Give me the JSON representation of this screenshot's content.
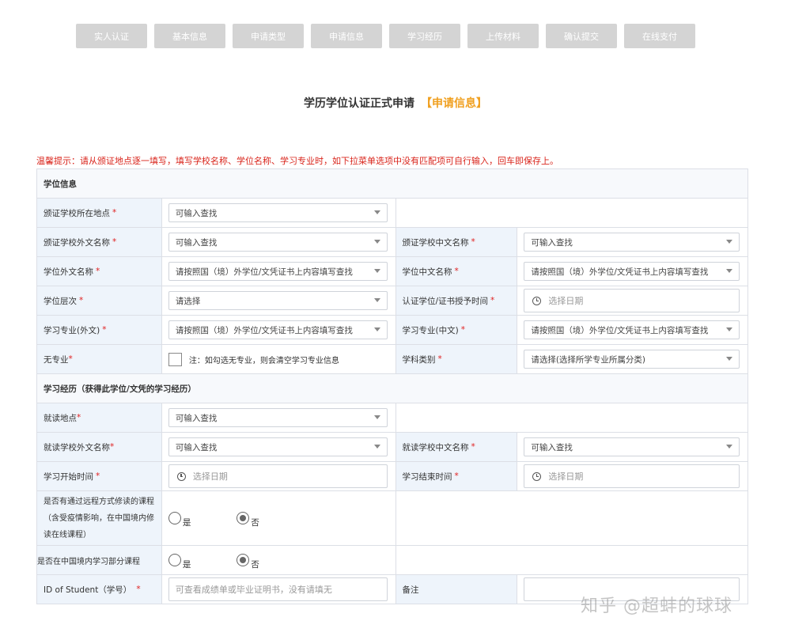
{
  "steps": [
    "实人认证",
    "基本信息",
    "申请类型",
    "申请信息",
    "学习经历",
    "上传材料",
    "确认提交",
    "在线支付"
  ],
  "title": {
    "main": "学历学位认证正式申请",
    "highlight": "【申请信息】"
  },
  "tip": "温馨提示：请从颁证地点逐一填写，填写学校名称、学位名称、学习专业时，如下拉菜单选项中没有匹配项可自行输入，回车即保存上。",
  "required_mark": "*",
  "section1": "学位信息",
  "rows1": {
    "issue_location": {
      "label": "颁证学校所在地点",
      "value": "可输入查找"
    },
    "school_foreign": {
      "label": "颁证学校外文名称",
      "value": "可输入查找"
    },
    "school_chinese": {
      "label": "颁证学校中文名称",
      "value": "可输入查找"
    },
    "degree_foreign": {
      "label": "学位外文名称",
      "value": "请按照国（境）外学位/文凭证书上内容填写查找"
    },
    "degree_chinese": {
      "label": "学位中文名称",
      "value": "请按照国（境）外学位/文凭证书上内容填写查找"
    },
    "degree_level": {
      "label": "学位层次",
      "value": "请选择"
    },
    "grant_date": {
      "label": "认证学位/证书授予时间",
      "placeholder": "选择日期"
    },
    "major_foreign": {
      "label": "学习专业(外文)",
      "value": "请按照国（境）外学位/文凭证书上内容填写查找"
    },
    "major_chinese": {
      "label": "学习专业(中文)",
      "value": "请按照国（境）外学位/文凭证书上内容填写查找"
    },
    "no_major": {
      "label": "无专业",
      "note": "注：如勾选无专业，则会清空学习专业信息"
    },
    "discipline": {
      "label": "学科类别",
      "value": "请选择(选择所学专业所属分类)"
    }
  },
  "section2": "学习经历（获得此学位/文凭的学习经历）",
  "rows2": {
    "study_location": {
      "label": "就读地点",
      "value": "可输入查找"
    },
    "study_school_foreign": {
      "label": "就读学校外文名称",
      "value": "可输入查找"
    },
    "study_school_chinese": {
      "label": "就读学校中文名称",
      "value": "可输入查找"
    },
    "start_date": {
      "label": "学习开始时间",
      "placeholder": "选择日期"
    },
    "end_date": {
      "label": "学习结束时间",
      "placeholder": "选择日期"
    },
    "remote": {
      "label": "是否有通过远程方式修读的课程（含受疫情影响，在中国境内修读在线课程）",
      "yes": "是",
      "no": "否"
    },
    "china_part": {
      "label": "是否在中国境内学习部分课程",
      "yes": "是",
      "no": "否"
    },
    "student_id": {
      "label": "ID of Student（学号）",
      "placeholder": "可查看成绩单或毕业证明书，没有请填无"
    },
    "remark": {
      "label": "备注"
    }
  },
  "watermark": "知乎 @超蚌的球球"
}
